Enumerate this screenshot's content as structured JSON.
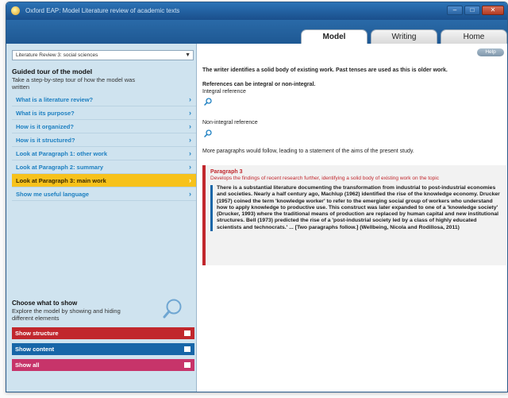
{
  "window": {
    "title": "Oxford EAP: Model Literature review of academic texts",
    "controls": {
      "minimize": "–",
      "maximize": "□",
      "close": "✕"
    }
  },
  "tabs": [
    {
      "label": "Model",
      "active": true
    },
    {
      "label": "Writing",
      "active": false
    },
    {
      "label": "Home",
      "active": false
    }
  ],
  "sidebar": {
    "dropdown_value": "Literature Review 3: social sciences",
    "tour_title": "Guided tour of the model",
    "tour_desc": "Take a step-by-step tour of how the model was written",
    "items": [
      {
        "label": "What is a literature review?",
        "selected": false
      },
      {
        "label": "What is its purpose?",
        "selected": false
      },
      {
        "label": "How is it organized?",
        "selected": false
      },
      {
        "label": "How is it structured?",
        "selected": false
      },
      {
        "label": "Look at Paragraph 1: other work",
        "selected": false
      },
      {
        "label": "Look at Paragraph 2: summary",
        "selected": false
      },
      {
        "label": "Look at Paragraph 3: main work",
        "selected": true
      },
      {
        "label": "Show me useful language",
        "selected": false
      }
    ],
    "choose_title": "Choose what to show",
    "choose_desc": "Explore the model by showing and hiding different elements",
    "toggles": [
      {
        "label": "Show structure",
        "color": "#c1272d"
      },
      {
        "label": "Show content",
        "color": "#1766a8"
      },
      {
        "label": "Show all",
        "color": "#c7346a"
      }
    ]
  },
  "main": {
    "help_label": "Help",
    "line1": "The writer identifies a solid body of existing work. Past tenses are used as this is older work.",
    "line2": "References can be integral or non-integral.",
    "line3": "Integral reference",
    "line4": "Non-integral reference",
    "line5": "More paragraphs would follow, leading to a statement of the aims of the present study.",
    "para_head": "Paragraph 3",
    "para_sub": "Develops the findings of recent research further, identifying a solid body of existing work on the topic",
    "para_body": "There is a substantial literature documenting the transformation from industrial to post-industrial economies and societies. Nearly a half century ago, Machlup (1962) identified the rise of the knowledge economy. Drucker (1957) coined the term 'knowledge worker' to refer to the emerging social group of workers who understand how to apply knowledge to productive use. This construct was later expanded to one of a 'knowledge society' (Drucker, 1993) where the traditional means of production are replaced by human capital and new institutional structures. Bell (1973) predicted the rise of a 'post-industrial society led by a class of highly educated scientists and technocrats.' ... [Two paragraphs follow.] (Wellbeing, Nicola and Rodillosa, 2011)"
  },
  "colors": {
    "accent_blue": "#1c7fc1",
    "selected_yellow": "#f7c21b",
    "structure_red": "#c1272d",
    "content_blue": "#1766a8",
    "all_pink": "#c7346a"
  }
}
